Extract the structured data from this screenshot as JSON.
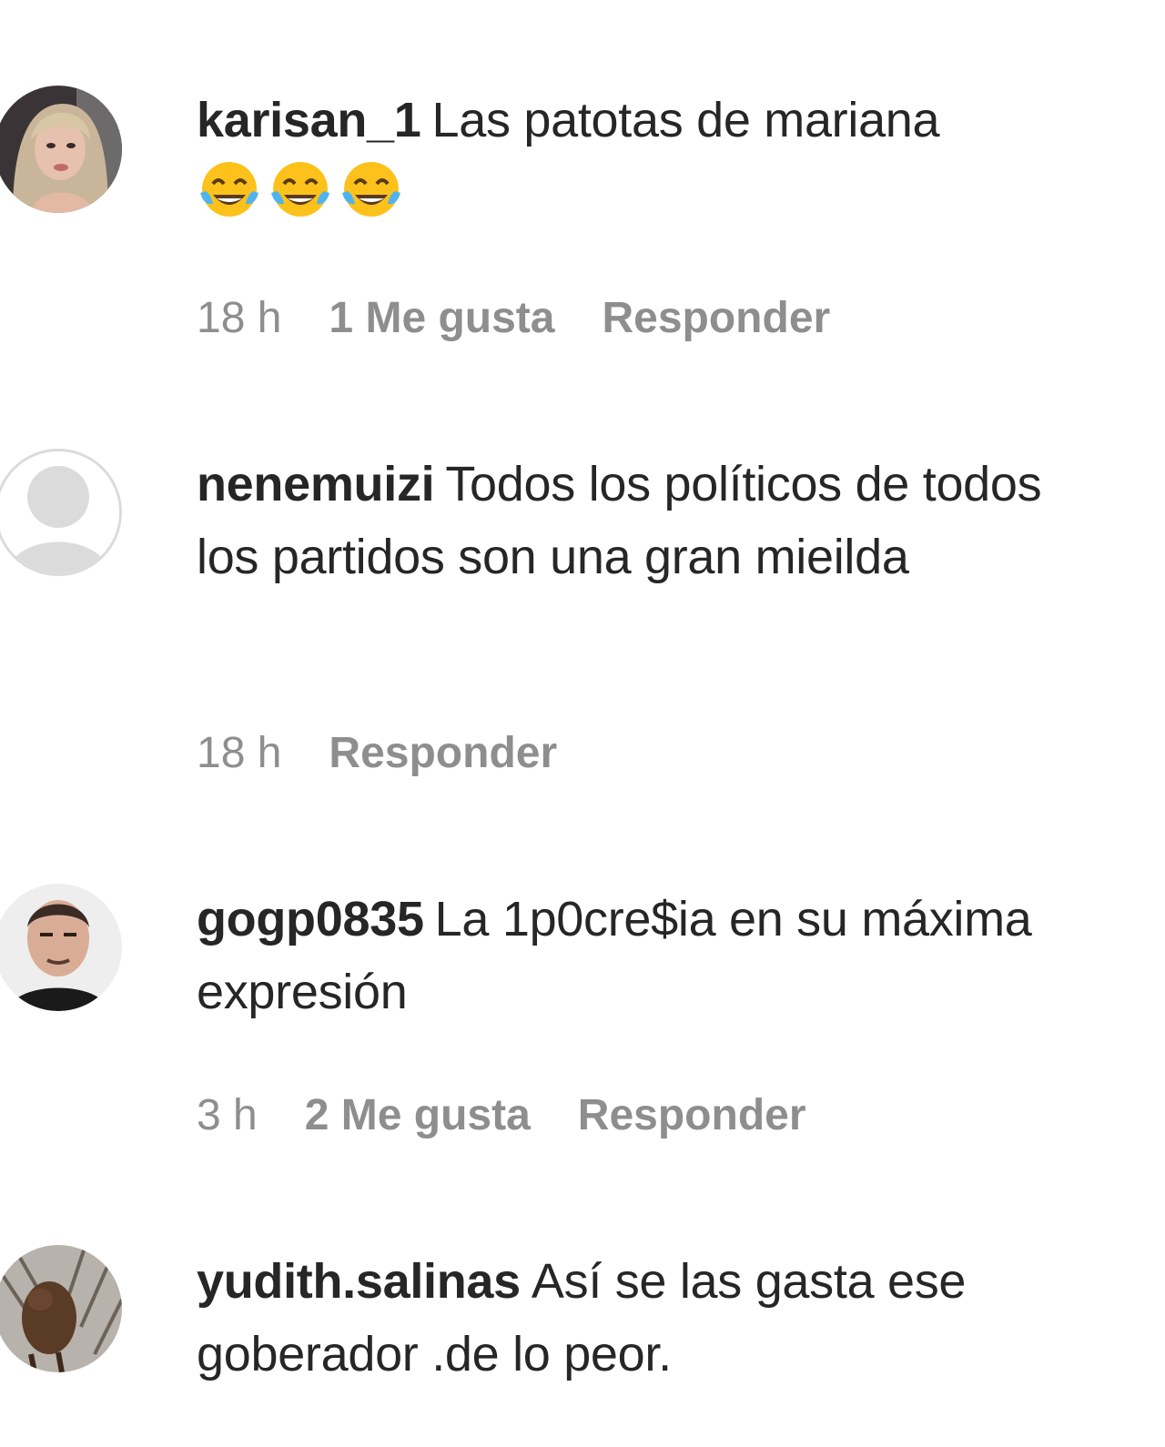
{
  "comments": [
    {
      "username": "karisan_1",
      "text": "Las patotas de mariana",
      "emoji": [
        "😂",
        "😂",
        "😂"
      ],
      "time": "18 h",
      "likes": "1 Me gusta",
      "reply": "Responder"
    },
    {
      "username": "nenemuizi",
      "text": "Todos los políticos de todos los partidos son una gran mieilda",
      "time": "18 h",
      "likes": "",
      "reply": "Responder"
    },
    {
      "username": "gogp0835",
      "text": "La 1p0cre$ia en su máxima expresión",
      "time": "3 h",
      "likes": "2 Me gusta",
      "reply": "Responder"
    },
    {
      "username": "yudith.salinas",
      "text": "Así se las gasta ese goberador .de lo peor.",
      "time": "",
      "likes": "",
      "reply": ""
    }
  ],
  "icons": {
    "emoji": "face-with-tears-of-joy-icon",
    "default_avatar": "default-avatar-icon"
  },
  "colors": {
    "text": "#262626",
    "meta": "#8e8e8e",
    "avatar_placeholder": "#dbdbdb"
  }
}
